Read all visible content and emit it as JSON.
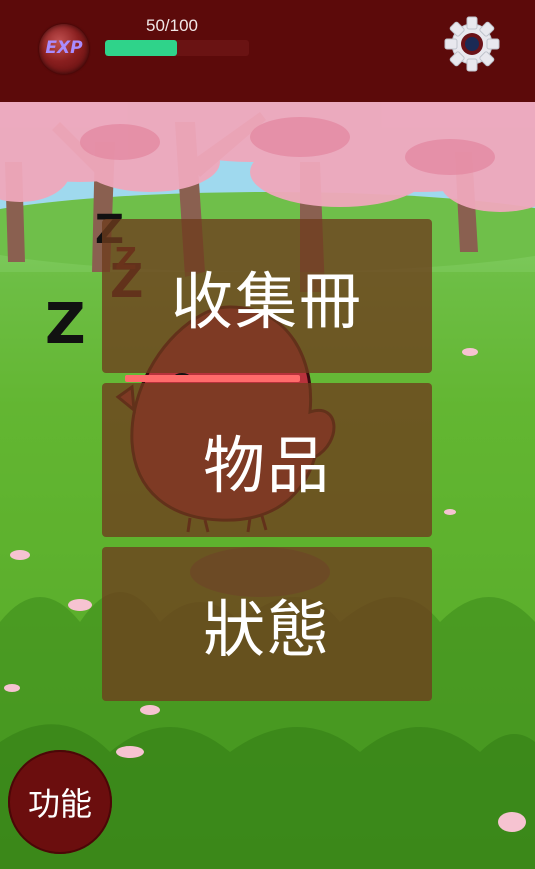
{
  "hud": {
    "exp_label": "EXP",
    "exp_text": "50/100",
    "exp_progress": 0.5,
    "settings_icon": "gear-icon"
  },
  "menu": {
    "items": [
      {
        "label": "收集冊"
      },
      {
        "label": "物品"
      },
      {
        "label": "狀態"
      }
    ]
  },
  "character": {
    "sleep_marks": [
      "Z",
      "Z",
      "Z",
      "Z"
    ]
  },
  "function_button": {
    "label": "功能"
  },
  "colors": {
    "topbar": "#5c0a0a",
    "exp_fill": "#2fd38a",
    "exp_track": "#6a1313",
    "menu_button": "#6e3c1e",
    "function_button": "#6b0e0e",
    "bird": "#b8323c"
  }
}
